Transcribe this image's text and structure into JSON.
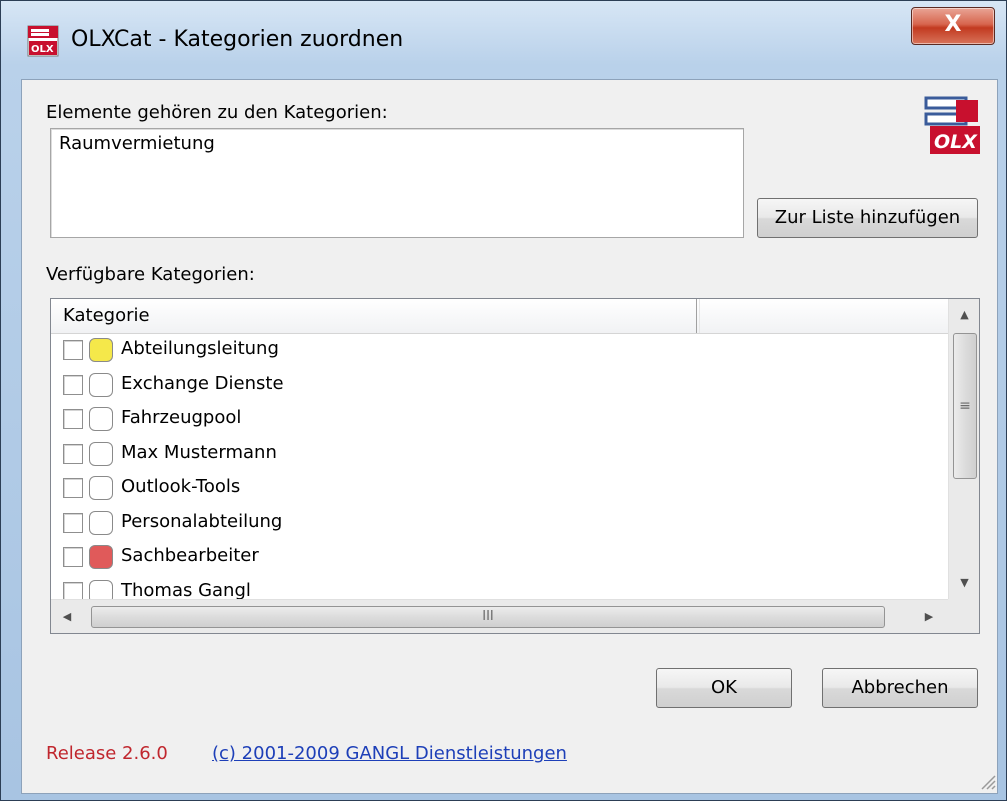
{
  "window": {
    "title": "OLXCat - Kategorien zuordnen",
    "close_glyph": "X"
  },
  "assigned": {
    "label": "Elemente gehören zu den Kategorien:",
    "value": "Raumvermietung"
  },
  "add_button": "Zur Liste hinzufügen",
  "available": {
    "label": "Verfügbare Kategorien:",
    "column_header": "Kategorie",
    "items": [
      {
        "name": "Abteilungsleitung",
        "checked": false,
        "color": "#f5e84a"
      },
      {
        "name": "Exchange Dienste",
        "checked": false,
        "color": "#ffffff"
      },
      {
        "name": "Fahrzeugpool",
        "checked": false,
        "color": "#ffffff"
      },
      {
        "name": "Max Mustermann",
        "checked": false,
        "color": "#ffffff"
      },
      {
        "name": "Outlook-Tools",
        "checked": false,
        "color": "#ffffff"
      },
      {
        "name": "Personalabteilung",
        "checked": false,
        "color": "#ffffff"
      },
      {
        "name": "Sachbearbeiter",
        "checked": false,
        "color": "#e05a5a"
      },
      {
        "name": "Thomas Gangl",
        "checked": false,
        "color": "#ffffff"
      }
    ]
  },
  "buttons": {
    "ok": "OK",
    "cancel": "Abbrechen"
  },
  "footer": {
    "release": "Release 2.6.0",
    "link": "(c) 2001-2009 GANGL Dienstleistungen"
  },
  "logo_text": "OLX",
  "icons": {
    "app": "olx-app-icon",
    "logo": "olx-logo-icon",
    "scroll_up": "scroll-up-arrow-icon",
    "scroll_down": "scroll-down-arrow-icon",
    "scroll_left": "scroll-left-arrow-icon",
    "scroll_right": "scroll-right-arrow-icon",
    "resize_grip": "resize-grip-icon"
  }
}
